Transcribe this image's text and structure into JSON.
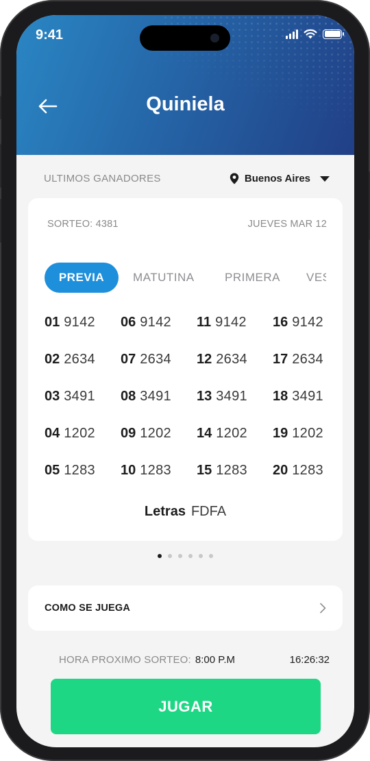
{
  "status_bar": {
    "time": "9:41"
  },
  "header": {
    "title": "Quiniela",
    "back_icon": "arrow-left-icon"
  },
  "section": {
    "label": "ULTIMOS GANADORES",
    "location": "Buenos Aires",
    "location_icon": "map-pin-icon"
  },
  "draw": {
    "sorteo": "SORTEO: 4381",
    "date": "JUEVES MAR 12",
    "tabs": [
      {
        "label": "PREVIA",
        "active": true
      },
      {
        "label": "MATUTINA",
        "active": false
      },
      {
        "label": "PRIMERA",
        "active": false
      },
      {
        "label": "VESPERTINA",
        "active": false
      }
    ],
    "results": [
      {
        "pos": "01",
        "num": "9142"
      },
      {
        "pos": "02",
        "num": "2634"
      },
      {
        "pos": "03",
        "num": "3491"
      },
      {
        "pos": "04",
        "num": "1202"
      },
      {
        "pos": "05",
        "num": "1283"
      },
      {
        "pos": "06",
        "num": "9142"
      },
      {
        "pos": "07",
        "num": "2634"
      },
      {
        "pos": "08",
        "num": "3491"
      },
      {
        "pos": "09",
        "num": "1202"
      },
      {
        "pos": "10",
        "num": "1283"
      },
      {
        "pos": "11",
        "num": "9142"
      },
      {
        "pos": "12",
        "num": "2634"
      },
      {
        "pos": "13",
        "num": "3491"
      },
      {
        "pos": "14",
        "num": "1202"
      },
      {
        "pos": "15",
        "num": "1283"
      },
      {
        "pos": "16",
        "num": "9142"
      },
      {
        "pos": "17",
        "num": "2634"
      },
      {
        "pos": "18",
        "num": "3491"
      },
      {
        "pos": "19",
        "num": "1202"
      },
      {
        "pos": "20",
        "num": "1283"
      }
    ],
    "letras_label": "Letras",
    "letras_value": "FDFA"
  },
  "pager": {
    "count": 6,
    "active_index": 0
  },
  "how_to_play": {
    "label": "COMO SE JUEGA",
    "icon": "chevron-right-icon"
  },
  "next_draw": {
    "label": "HORA PROXIMO SORTEO:",
    "time": "8:00 P.M",
    "countdown": "16:26:32"
  },
  "cta": {
    "label": "JUGAR"
  },
  "colors": {
    "primary": "#1d8fdb",
    "cta": "#1ed784",
    "header_start": "#2a86c3",
    "header_end": "#213f86",
    "background": "#f4f4f4"
  }
}
